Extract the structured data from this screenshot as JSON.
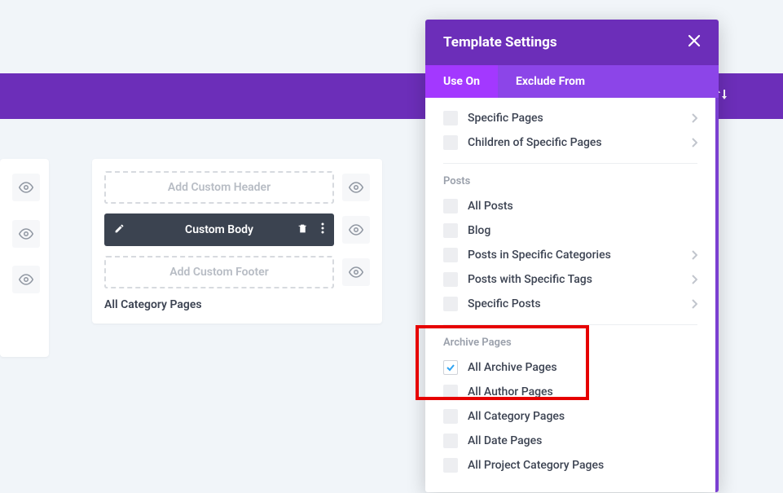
{
  "purple_bar": {
    "sort_icon": "sort"
  },
  "template_card": {
    "rows": {
      "header": {
        "label": "Add Custom Header"
      },
      "body": {
        "label": "Custom Body"
      },
      "footer": {
        "label": "Add Custom Footer"
      }
    },
    "footer_label": "All Category Pages"
  },
  "settings": {
    "title": "Template Settings",
    "tabs": {
      "use_on": "Use On",
      "exclude": "Exclude From"
    },
    "pages_items": {
      "specific": "Specific Pages",
      "children": "Children of Specific Pages"
    },
    "posts_label": "Posts",
    "posts_items": {
      "all": "All Posts",
      "blog": "Blog",
      "cats": "Posts in Specific Categories",
      "tags": "Posts with Specific Tags",
      "specific": "Specific Posts"
    },
    "archive_label": "Archive Pages",
    "archive_items": {
      "all": "All Archive Pages",
      "author": "All Author Pages",
      "category": "All Category Pages",
      "date": "All Date Pages",
      "project_cat": "All Project Category Pages"
    }
  }
}
